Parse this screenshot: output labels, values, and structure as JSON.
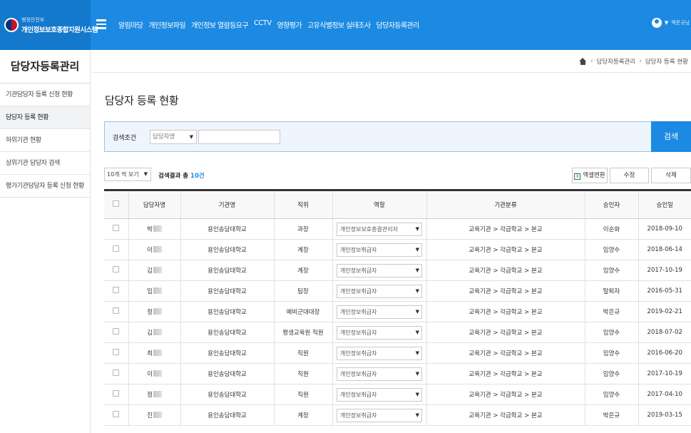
{
  "header": {
    "logo_sub": "행정안전부",
    "logo_main": "개인정보보호종합지원시스템",
    "nav": [
      "알림마당",
      "개인정보파일",
      "개인정보 열람등요구",
      "CCTV",
      "영향평가",
      "고유식별정보 실태조사",
      "담당자등록관리"
    ],
    "user_name": "맥준규님"
  },
  "sidebar": {
    "title": "담당자등록관리",
    "items": [
      {
        "label": "기관담당자 등록 신청 현황",
        "active": false
      },
      {
        "label": "담당자 등록 현황",
        "active": true
      },
      {
        "label": "하위기관 현황",
        "active": false
      },
      {
        "label": "상위기관 담당자 검색",
        "active": false
      },
      {
        "label": "평가기관담당자 등록 신청 현황",
        "active": false
      }
    ]
  },
  "breadcrumb": [
    "담당자등록관리",
    "담당자 등록 현황"
  ],
  "page_title": "담당자 등록 현황",
  "search": {
    "label": "검색조건",
    "select_value": "담당자명",
    "input_value": "",
    "button": "검색"
  },
  "list_controls": {
    "page_size": "10개 씩 보기",
    "result_prefix": "검색결과 총 ",
    "result_count": "10건",
    "excel_button": "엑셀변환",
    "edit_button": "수정",
    "delete_button": "삭제"
  },
  "table": {
    "headers": [
      "",
      "담당자명",
      "기관명",
      "직위",
      "역할",
      "기관분류",
      "승인자",
      "승인일"
    ],
    "rows": [
      {
        "name": "박",
        "org": "용인송담대학교",
        "position": "과장",
        "role": "개인정보보호총괄관리자",
        "category": "교육기관 > 각급학교 > 본교",
        "approver": "이순화",
        "date": "2018-09-10"
      },
      {
        "name": "이",
        "org": "용인송담대학교",
        "position": "계장",
        "role": "개인정보취급자",
        "category": "교육기관 > 각급학교 > 본교",
        "approver": "임양수",
        "date": "2018-06-14"
      },
      {
        "name": "김",
        "org": "용인송담대학교",
        "position": "계장",
        "role": "개인정보취급자",
        "category": "교육기관 > 각급학교 > 본교",
        "approver": "임양수",
        "date": "2017-10-19"
      },
      {
        "name": "임",
        "org": "용인송담대학교",
        "position": "팀장",
        "role": "개인정보취급자",
        "category": "교육기관 > 각급학교 > 본교",
        "approver": "탈퇴자",
        "date": "2016-05-31"
      },
      {
        "name": "정",
        "org": "용인송담대학교",
        "position": "예비군대대장",
        "role": "개인정보취급자",
        "category": "교육기관 > 각급학교 > 본교",
        "approver": "박은규",
        "date": "2019-02-21"
      },
      {
        "name": "김",
        "org": "용인송담대학교",
        "position": "평생교육원 직원",
        "role": "개인정보취급자",
        "category": "교육기관 > 각급학교 > 본교",
        "approver": "임양수",
        "date": "2018-07-02"
      },
      {
        "name": "최",
        "org": "용인송담대학교",
        "position": "직원",
        "role": "개인정보취급자",
        "category": "교육기관 > 각급학교 > 본교",
        "approver": "임양수",
        "date": "2016-06-20"
      },
      {
        "name": "이",
        "org": "용인송담대학교",
        "position": "직원",
        "role": "개인정보취급자",
        "category": "교육기관 > 각급학교 > 본교",
        "approver": "임양수",
        "date": "2017-10-19"
      },
      {
        "name": "정",
        "org": "용인송담대학교",
        "position": "직원",
        "role": "개인정보취급자",
        "category": "교육기관 > 각급학교 > 본교",
        "approver": "임양수",
        "date": "2017-04-10"
      },
      {
        "name": "진",
        "org": "용인송담대학교",
        "position": "계장",
        "role": "개인정보취급자",
        "category": "교육기관 > 각급학교 > 본교",
        "approver": "박은규",
        "date": "2019-03-15"
      }
    ]
  },
  "colors": {
    "primary": "#1c8ae2",
    "logo_bg": "#1479cc",
    "search_bg": "#eef5fc"
  }
}
